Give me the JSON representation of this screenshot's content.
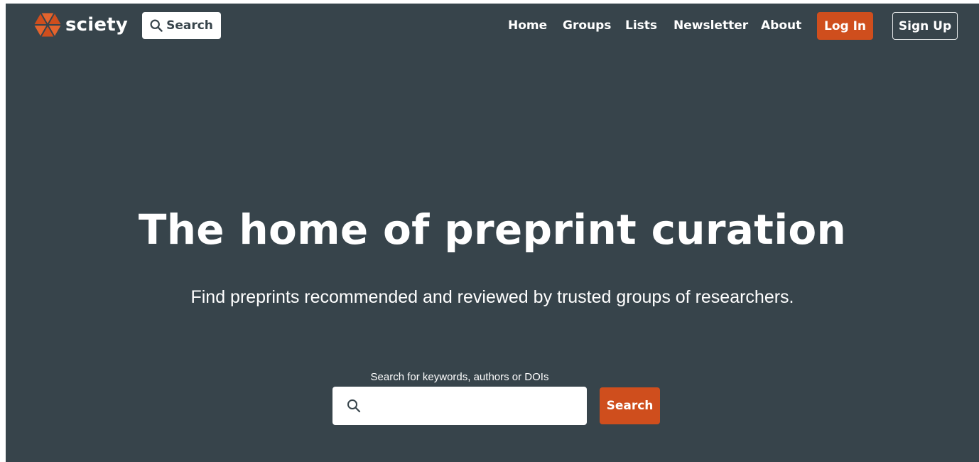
{
  "brand": {
    "name": "sciety",
    "logo_icon": "sciety-logo-icon",
    "accent_color": "#cf4e1d",
    "background_color": "#37444b"
  },
  "header": {
    "search_label": "Search",
    "search_icon": "search-icon",
    "nav": [
      {
        "label": "Home"
      },
      {
        "label": "Groups"
      },
      {
        "label": "Lists"
      },
      {
        "label": "Newsletter"
      },
      {
        "label": "About"
      }
    ],
    "login_label": "Log In",
    "signup_label": "Sign Up"
  },
  "hero": {
    "title": "The home of preprint curation",
    "subtitle": "Find preprints recommended and reviewed by trusted groups of researchers."
  },
  "search": {
    "label": "Search for keywords, authors or DOIs",
    "value": "",
    "placeholder": "",
    "button_label": "Search",
    "icon": "search-icon"
  }
}
